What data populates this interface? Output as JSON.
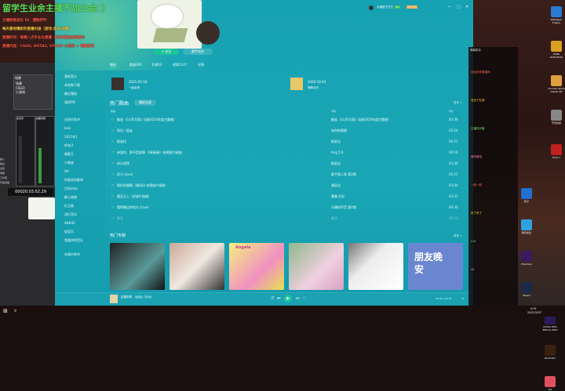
{
  "overlay": {
    "title": "留学生业余主播不加公会：）",
    "line1": "主播网易音乐 ID：遇晚伊乔",
    "line2": "每天都有精彩的直播内容（游戏·音乐·闲聊）",
    "line3": "直播时间：每晚八点半左右直播（具体看粉丝群通知）",
    "line4": "直播内容：CSGO, DOTA2, STEAM 小游戏 + 唱歌聊天"
  },
  "obs": {
    "sources_title": "场景",
    "sources": [
      "场景",
      "CSGO",
      "小游戏"
    ],
    "mixer": [
      "麦克风",
      "桌面音频"
    ],
    "controls": [
      "插入",
      "输出",
      "设置",
      "录制",
      "工作室",
      "开始直播"
    ],
    "timer": "00020.03.02.29"
  },
  "app": {
    "header": {
      "user": "大锅饭子日日",
      "vip": "VIP",
      "badge": "年费会员",
      "follow_btn": "+ 关注",
      "radio_btn": "歌手电台"
    },
    "sidebar": {
      "items": [
        "我的音乐",
        "本地和下载",
        "最近播放",
        "我的FM"
      ],
      "section": "创建的歌单",
      "playlists": [
        "love",
        "2021年1",
        "听电子",
        "唱歌王",
        "小歌曲",
        "SH",
        "你喜欢的歌单",
        "古风emo",
        "爵士夜曲",
        "红尘曲",
        "流行音乐",
        "A&R45",
        "轻音乐",
        "我喜欢的音乐"
      ],
      "section2": "收藏的歌单"
    },
    "tabs": [
      "精选",
      "歌曲300",
      "专辑33",
      "视频1107",
      "详情"
    ],
    "new": [
      {
        "date": "2021-03-18",
        "title": "一起走吧"
      },
      {
        "date": "2020-10-03",
        "title": "我和月光"
      }
    ],
    "hot_songs": {
      "title": "热门歌曲",
      "play_all": "播放全部",
      "more": "更多 >",
      "col_title": "歌曲",
      "col_album": "专辑",
      "col_time": "时长",
      "rows": [
        {
          "title": "破茧（《斗罗大陆》动画2020年度主题曲）",
          "album": "破茧（《斗罗大陆》动画2020年度主题曲）",
          "time": "03:39"
        },
        {
          "title": "再见一面走",
          "album": "有你的版图",
          "time": "03:24"
        },
        {
          "title": "欧若拉",
          "album": "欧若拉",
          "time": "04:21"
        },
        {
          "title": "亲爱的，那不是爱情（《致青春》电视剧片尾曲）",
          "album": "Ang 5.0",
          "time": "04:16"
        },
        {
          "title": "快乐崇拜",
          "album": "欧若拉",
          "time": "03:30"
        },
        {
          "title": "阿刁 (Live)",
          "album": "歌手第二季 第2期",
          "time": "05:21"
        },
        {
          "title": "隐形的翅膀（潘朵拉 电视剧片尾曲）",
          "album": "潘朵拉",
          "time": "03:44"
        },
        {
          "title": "遇见之上（纪录片插曲）",
          "album": "最美 回忆",
          "time": "03:33"
        },
        {
          "title": "看得最远的地方 (Live)",
          "album": "天赐的声音 第2期",
          "time": "04:30"
        },
        {
          "title": "寓言",
          "album": "寓言",
          "time": "03:13"
        }
      ]
    },
    "hot_albums": {
      "title": "热门专辑",
      "more": "更多 >",
      "album6": "朋友晚安",
      "album3": "Angela"
    },
    "player": {
      "song": "如果的事",
      "artist": "张韶涵 / 范玮琪",
      "time": "00:00 / 03:44",
      "volume": "22"
    }
  },
  "chat": {
    "title": "弹幕助手",
    "lines": [
      "欢迎来到直播间",
      "送出了礼物",
      "主播好厉害",
      "哈哈哈哈",
      "一起一起",
      "来了来了",
      "x15",
      "x6"
    ]
  },
  "desktop": {
    "icons": [
      "Wallpaper Engine",
      "PUBG BATTLEGR",
      "Counter-Strike Global Off",
      "守望先锋",
      "Dota 2",
      "知乎",
      "腾讯会议",
      "Premiere",
      "Steam",
      "Adobe After Effects 2020",
      "Illustrator",
      "QQ"
    ]
  },
  "taskbar": {
    "time": "0:01",
    "date": "2021/5/07"
  }
}
